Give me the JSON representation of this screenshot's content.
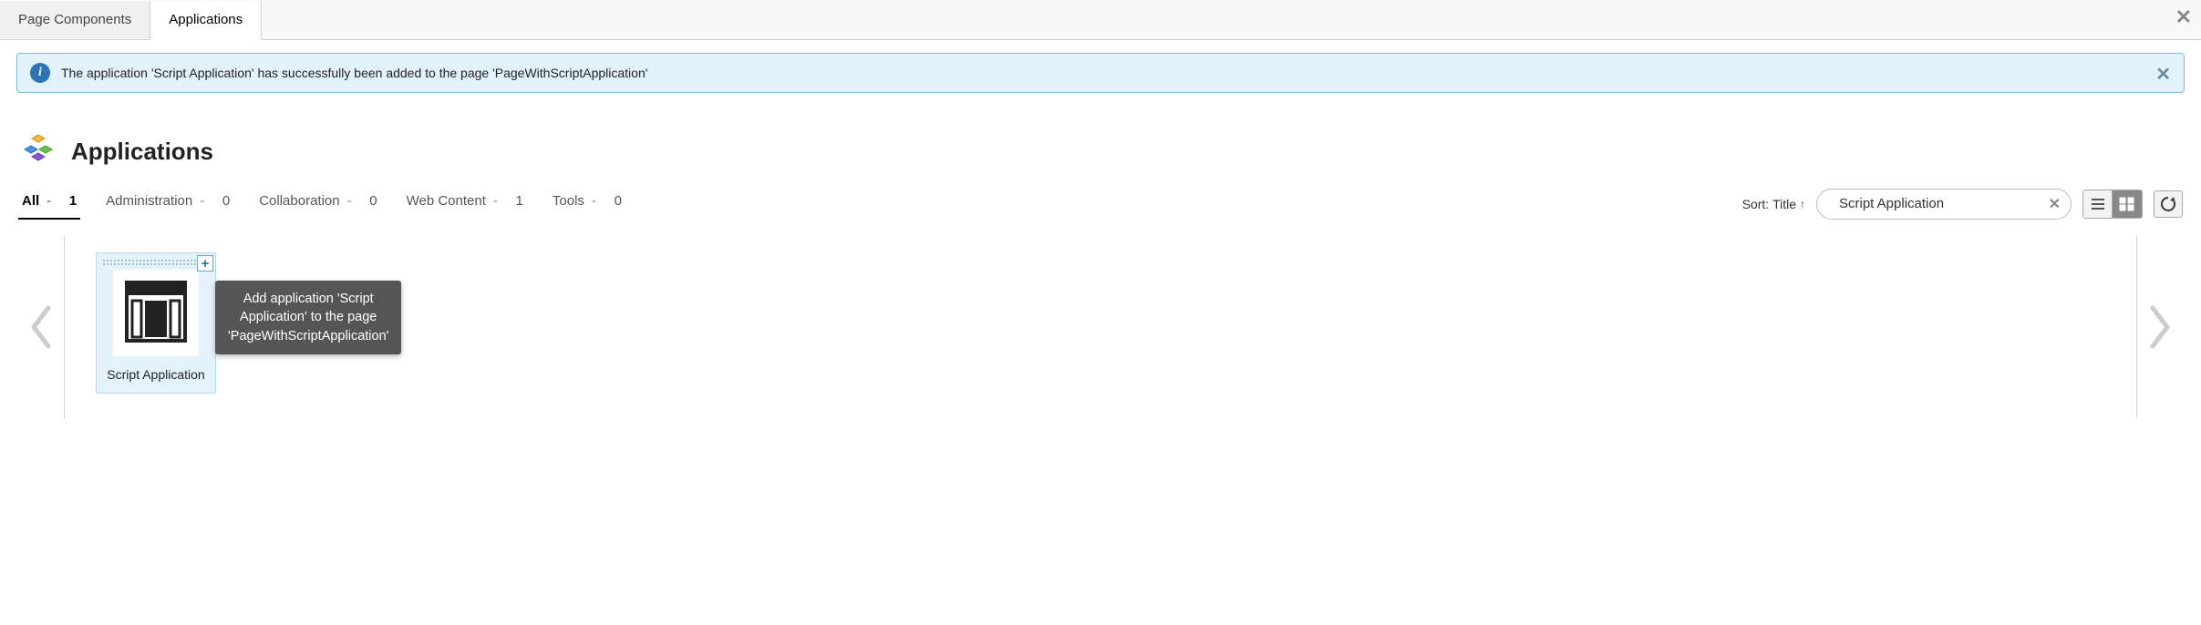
{
  "tabs": {
    "page_components": "Page Components",
    "applications": "Applications"
  },
  "notification": {
    "text": "The application 'Script Application' has successfully been added to the page 'PageWithScriptApplication'"
  },
  "header": {
    "title": "Applications"
  },
  "categories": [
    {
      "label": "All",
      "count": "1",
      "active": true
    },
    {
      "label": "Administration",
      "count": "0",
      "active": false
    },
    {
      "label": "Collaboration",
      "count": "0",
      "active": false
    },
    {
      "label": "Web Content",
      "count": "1",
      "active": false
    },
    {
      "label": "Tools",
      "count": "0",
      "active": false
    }
  ],
  "sort": {
    "prefix": "Sort:",
    "field": "Title"
  },
  "search": {
    "value": "Script Application"
  },
  "card": {
    "title": "Script Application"
  },
  "tooltip": {
    "text": "Add application 'Script Application' to the page 'PageWithScriptApplication'"
  }
}
